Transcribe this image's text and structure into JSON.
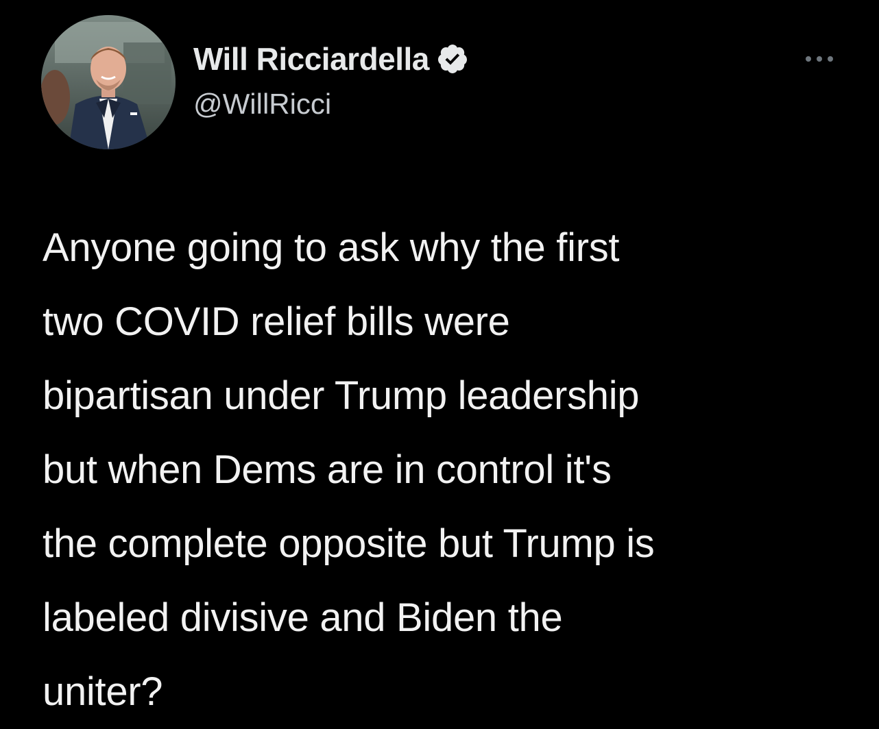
{
  "tweet": {
    "author": {
      "display_name": "Will Ricciardella",
      "handle": "@WillRicci",
      "verified": true,
      "avatar_icon": "profile-photo"
    },
    "more_icon": "ellipsis-icon",
    "text": "Anyone going to ask why the first\ntwo COVID relief bills were\nbipartisan under Trump leadership\nbut when Dems are in control it's\nthe complete opposite but Trump is\nlabeled divisive and Biden the\nuniter?"
  },
  "colors": {
    "background": "#000000",
    "primary_text": "#e7e9ea",
    "secondary_text": "#c7cbd0",
    "verified_badge": "#e7e9ea"
  }
}
